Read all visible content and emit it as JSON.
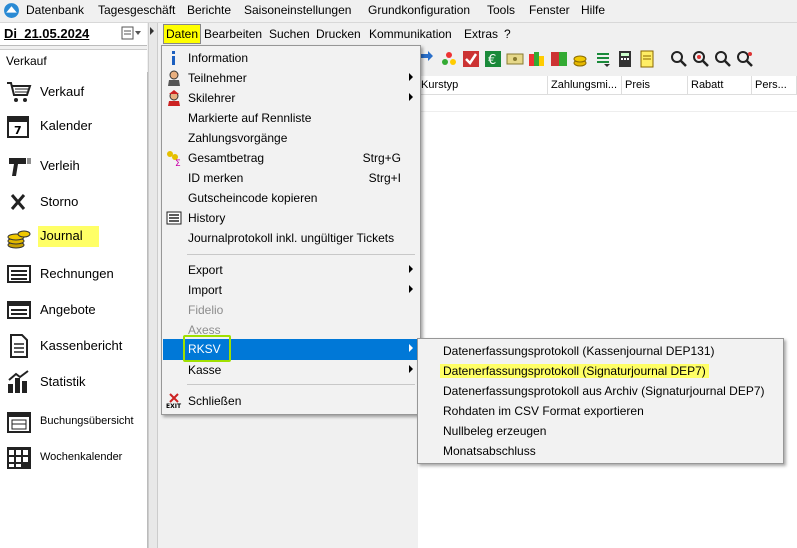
{
  "topmenu": [
    "Datenbank",
    "Tagesgeschäft",
    "Berichte",
    "Saisoneinstellungen",
    "Grundkonfiguration",
    "Tools",
    "Fenster",
    "Hilfe"
  ],
  "date": "Di  21.05.2024",
  "section": "Verkauf",
  "sidebar": [
    {
      "label": "Verkauf",
      "icon": "shopping-cart-icon"
    },
    {
      "label": "Kalender",
      "icon": "calendar-icon"
    },
    {
      "label": "Verleih",
      "icon": "barcode-scanner-icon"
    },
    {
      "label": "Storno",
      "icon": "close-icon"
    },
    {
      "label": "Journal",
      "icon": "coins-icon"
    },
    {
      "label": "Rechnungen",
      "icon": "invoice-list-icon"
    },
    {
      "label": "Angebote",
      "icon": "offer-list-icon"
    },
    {
      "label": "Kassenbericht",
      "icon": "document-icon"
    },
    {
      "label": "Statistik",
      "icon": "bar-chart-icon"
    },
    {
      "label": "Buchungsübersicht",
      "icon": "booking-overview-icon"
    },
    {
      "label": "Wochenkalender",
      "icon": "week-calendar-icon"
    }
  ],
  "menu2": [
    "Daten",
    "Bearbeiten",
    "Suchen",
    "Drucken",
    "Kommunikation",
    "Extras",
    "?"
  ],
  "columns": [
    "Kurstyp",
    "Zahlungsmi...",
    "Preis",
    "Rabatt",
    "Pers..."
  ],
  "dropdown": {
    "information": "Information",
    "teilnehmer": "Teilnehmer",
    "skilehrer": "Skilehrer",
    "markierte": "Markierte auf Rennliste",
    "zahlungsvorgaenge": "Zahlungsvorgänge",
    "gesamtbetrag": "Gesamtbetrag",
    "gesamtbetrag_shortcut": "Strg+G",
    "id_merken": "ID merken",
    "id_merken_shortcut": "Strg+I",
    "gutscheincode": "Gutscheincode kopieren",
    "history": "History",
    "journalprotokoll": "Journalprotokoll inkl. ungültiger Tickets",
    "export": "Export",
    "import": "Import",
    "fidelio": "Fidelio",
    "axess": "Axess",
    "rksv": "RKSV",
    "kasse": "Kasse",
    "schliessen": "Schließen"
  },
  "submenu": [
    "Datenerfassungsprotokoll (Kassenjournal DEP131)",
    "Datenerfassungsprotokoll (Signaturjournal DEP7)",
    "Datenerfassungsprotokoll aus Archiv (Signaturjournal DEP7)",
    "Rohdaten im CSV Format exportieren",
    "Nullbeleg erzeugen",
    "Monatsabschluss"
  ],
  "colors": {
    "highlight": "#0078d7",
    "marker_yellow": "#ffff66",
    "marker_green": "#a0e000"
  }
}
